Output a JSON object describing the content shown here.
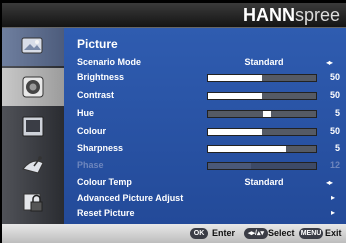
{
  "brand": {
    "bold": "HANN",
    "light": "spree"
  },
  "menu": {
    "title": "Picture",
    "rows": [
      {
        "label": "Scenario Mode",
        "value": "Standard",
        "arrows": "◂▸"
      },
      {
        "label": "Brightness",
        "num": "50",
        "level": 0.5
      },
      {
        "label": "Contrast",
        "num": "50",
        "level": 0.5
      },
      {
        "label": "Hue",
        "num": "5",
        "level": 0.55
      },
      {
        "label": "Colour",
        "num": "50",
        "level": 0.5
      },
      {
        "label": "Sharpness",
        "num": "5",
        "level": 0.72
      },
      {
        "label": "Phase",
        "num": "12",
        "level": 0.4
      },
      {
        "label": "Colour Temp",
        "value": "Standard",
        "arrows": "◂▸"
      },
      {
        "label": "Advanced Picture Adjust",
        "arrow": "▸"
      },
      {
        "label": "Reset Picture",
        "arrow": "▸"
      }
    ]
  },
  "sidebar": {
    "items": [
      {
        "icon": "picture-icon",
        "state": "active"
      },
      {
        "icon": "speaker-icon",
        "state": "selected"
      },
      {
        "icon": "display-icon",
        "state": "normal"
      },
      {
        "icon": "satellite-icon",
        "state": "normal"
      },
      {
        "icon": "lock-icon",
        "state": "normal"
      }
    ]
  },
  "footer": {
    "ok_key": "OK",
    "enter_label": "Enter",
    "nav_key": "◂▸/▴▾",
    "select_label": "Select",
    "menu_key": "MENU",
    "exit_label": "Exit"
  },
  "colors": {
    "panel": "#2a55a8",
    "header": "#1e1e1e",
    "footer": "#d4d4d4"
  }
}
